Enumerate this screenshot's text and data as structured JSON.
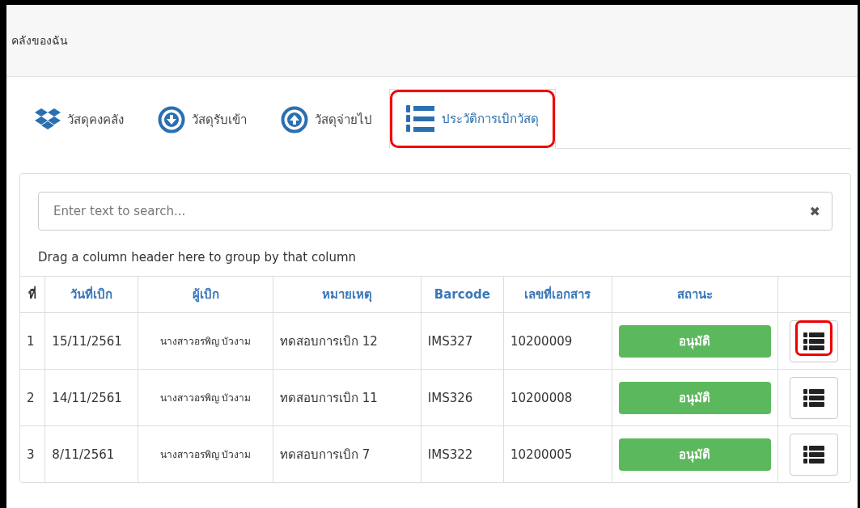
{
  "header": {
    "title": "คลังของฉัน"
  },
  "tabs": [
    {
      "label": "วัสดุคงคลัง",
      "kind": "boxes",
      "selected": false,
      "highlighted": false
    },
    {
      "label": "วัสดุรับเข้า",
      "kind": "down",
      "selected": false,
      "highlighted": false
    },
    {
      "label": "วัสดุจ่ายไป",
      "kind": "up",
      "selected": false,
      "highlighted": false
    },
    {
      "label": "ประวัติการเบิกวัสดุ",
      "kind": "numbered",
      "selected": true,
      "highlighted": true
    }
  ],
  "search": {
    "placeholder": "Enter text to search...",
    "clear": "✖"
  },
  "group_hint": "Drag a column header here to group by that column",
  "table": {
    "columns": [
      "ที่",
      "วันที่เบิก",
      "ผู้เบิก",
      "หมายเหตุ",
      "Barcode",
      "เลขที่เอกสาร",
      "สถานะ"
    ],
    "rows": [
      {
        "no": "1",
        "date": "15/11/2561",
        "requester": "นางสาวอรพิญ บัวงาม",
        "note": "ทดสอบการเบิก 12",
        "barcode": "IMS327",
        "doc": "10200009",
        "status": "อนุมัติ",
        "highlighted": true
      },
      {
        "no": "2",
        "date": "14/11/2561",
        "requester": "นางสาวอรพิญ บัวงาม",
        "note": "ทดสอบการเบิก 11",
        "barcode": "IMS326",
        "doc": "10200008",
        "status": "อนุมัติ",
        "highlighted": false
      },
      {
        "no": "3",
        "date": "8/11/2561",
        "requester": "นางสาวอรพิญ บัวงาม",
        "note": "ทดสอบการเบิก 7",
        "barcode": "IMS322",
        "doc": "10200005",
        "status": "อนุมัติ",
        "highlighted": false
      }
    ]
  }
}
